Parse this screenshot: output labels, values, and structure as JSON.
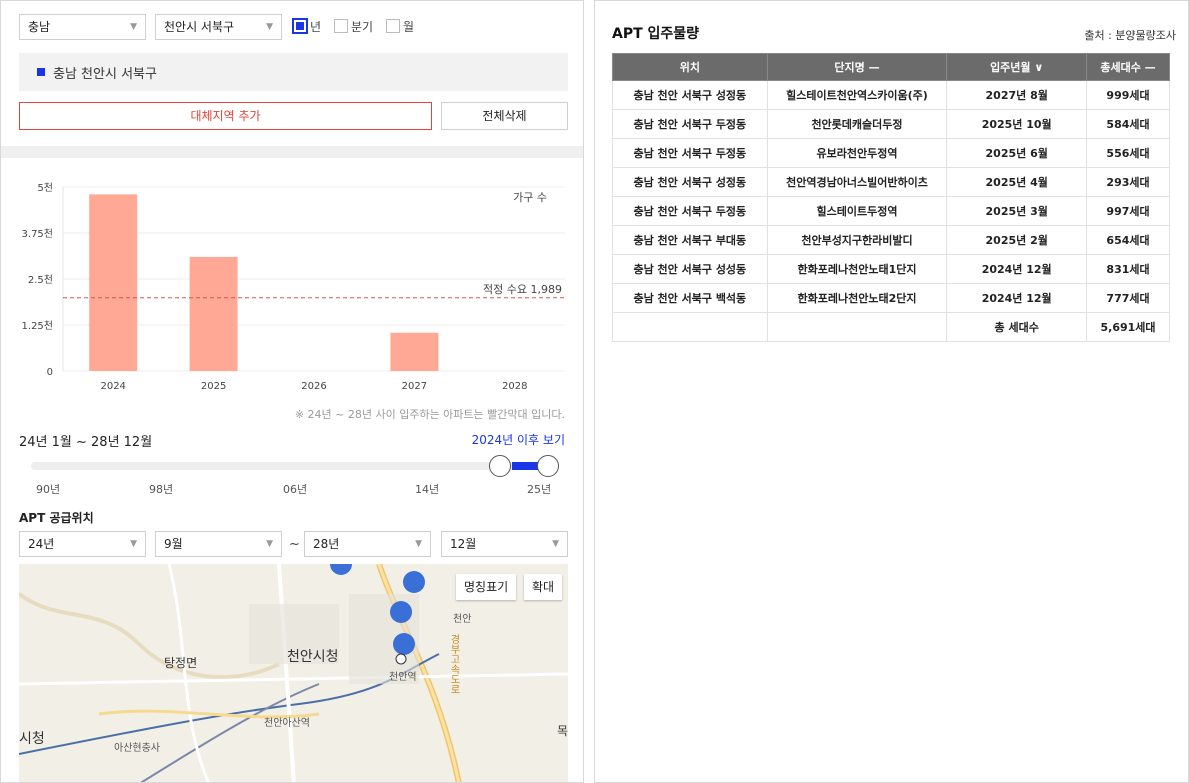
{
  "filters": {
    "province": "충남",
    "city": "천안시 서북구",
    "period_options": [
      {
        "label": "년",
        "checked": true
      },
      {
        "label": "분기",
        "checked": false
      },
      {
        "label": "월",
        "checked": false
      }
    ]
  },
  "selected_region": "충남 천안시 서북구",
  "buttons": {
    "add_alt_region": "대체지역 추가",
    "delete_all": "전체삭제"
  },
  "chart_data": {
    "type": "bar",
    "categories": [
      "2024",
      "2025",
      "2026",
      "2027",
      "2028"
    ],
    "values": [
      4800,
      3100,
      0,
      1040,
      0
    ],
    "ylim": [
      0,
      5000
    ],
    "yticks": [
      "0",
      "1.25천",
      "2.5천",
      "3.75천",
      "5천"
    ],
    "series_label": "가구 수",
    "reference_line": {
      "label": "적정 수요 1,989",
      "value": 1989
    },
    "bar_color": "#ffa896",
    "reference_color": "#d9534f"
  },
  "chart_note": "※ 24년 ~ 28년 사이 입주하는 아파트는 빨간막대 입니다.",
  "range": {
    "label": "24년 1월 ~ 28년 12월",
    "link": "2024년 이후 보기",
    "ticks": [
      "90년",
      "98년",
      "06년",
      "14년",
      "25년"
    ]
  },
  "supply": {
    "title": "APT 공급위치",
    "from_year": "24년",
    "from_month": "9월",
    "separator": "~",
    "to_year": "28년",
    "to_month": "12월"
  },
  "map": {
    "name_toggle": "명칭표기",
    "zoom": "확대",
    "labels": {
      "cheonan_city_hall": "천안시청",
      "tangjeong": "탕정면",
      "cheonan_station": "천안역",
      "cheonan_asan_station": "천안아산역",
      "asan_station": "아산현충사",
      "city_hall_left": "시청",
      "highway": "경부고속도로",
      "east_label": "천안",
      "right_edge": "목"
    }
  },
  "table": {
    "title": "APT 입주물량",
    "source": "출처 : 분양물량조사",
    "headers": [
      "위치",
      "단지명 —",
      "입주년월 ∨",
      "총세대수 —"
    ],
    "rows": [
      [
        "충남 천안 서북구 성정동",
        "힐스테이트천안역스카이움(주)",
        "2027년 8월",
        "999세대"
      ],
      [
        "충남 천안 서북구 두정동",
        "천안롯데캐슬더두정",
        "2025년 10월",
        "584세대"
      ],
      [
        "충남 천안 서북구 두정동",
        "유보라천안두정역",
        "2025년 6월",
        "556세대"
      ],
      [
        "충남 천안 서북구 성정동",
        "천안역경남아너스빌어반하이츠",
        "2025년 4월",
        "293세대"
      ],
      [
        "충남 천안 서북구 두정동",
        "힐스테이트두정역",
        "2025년 3월",
        "997세대"
      ],
      [
        "충남 천안 서북구 부대동",
        "천안부성지구한라비발디",
        "2025년 2월",
        "654세대"
      ],
      [
        "충남 천안 서북구 성성동",
        "한화포레나천안노태1단지",
        "2024년 12월",
        "831세대"
      ],
      [
        "충남 천안 서북구 백석동",
        "한화포레나천안노태2단지",
        "2024년 12월",
        "777세대"
      ]
    ],
    "total_label": "총 세대수",
    "total_value": "5,691세대"
  }
}
